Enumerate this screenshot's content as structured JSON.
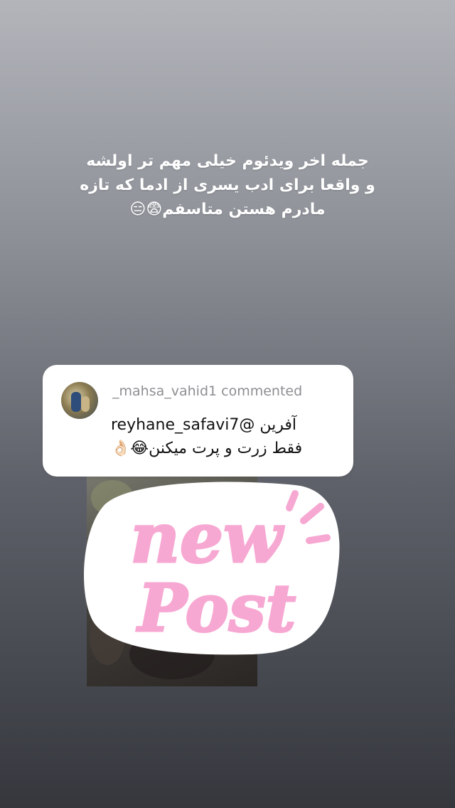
{
  "caption": {
    "line1": "جمله اخر ویدئوم خیلی مهم تر اولشه",
    "line2": "و واقعا برای ادب یسری از ادما که تازه",
    "line3": "مادرم هستن متاسفم😨😑"
  },
  "comment": {
    "username": "_mahsa_vahid1",
    "action": "commented",
    "line1": "آفرین @reyhane_safavi7",
    "line2": "فقط زرت و پرت میکنن😂👌🏻"
  },
  "sticker": {
    "line1": "new",
    "line2": "Post",
    "color": "#f7a8d2"
  }
}
